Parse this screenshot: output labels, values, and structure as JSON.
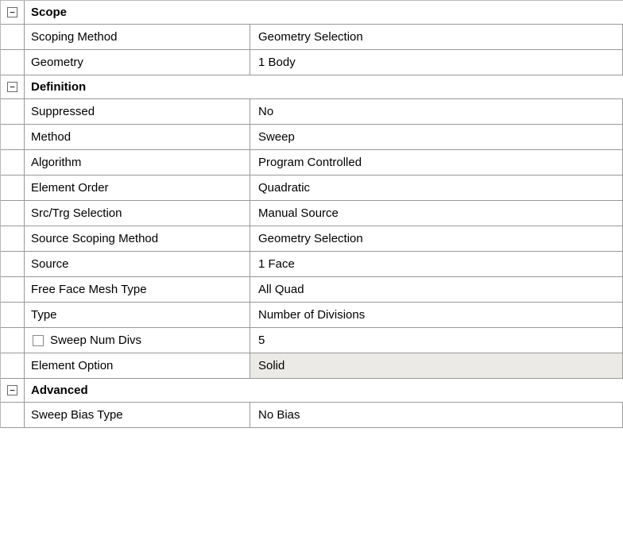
{
  "groups": [
    {
      "expand": "−",
      "title": "Scope",
      "rows": [
        {
          "label": "Scoping Method",
          "value": "Geometry Selection",
          "checkbox": false,
          "readonly": false
        },
        {
          "label": "Geometry",
          "value": "1 Body",
          "checkbox": false,
          "readonly": false
        }
      ]
    },
    {
      "expand": "−",
      "title": "Definition",
      "rows": [
        {
          "label": "Suppressed",
          "value": "No",
          "checkbox": false,
          "readonly": false
        },
        {
          "label": "Method",
          "value": "Sweep",
          "checkbox": false,
          "readonly": false
        },
        {
          "label": "Algorithm",
          "value": "Program Controlled",
          "checkbox": false,
          "readonly": false
        },
        {
          "label": "Element Order",
          "value": "Quadratic",
          "checkbox": false,
          "readonly": false
        },
        {
          "label": "Src/Trg Selection",
          "value": "Manual Source",
          "checkbox": false,
          "readonly": false
        },
        {
          "label": "Source Scoping Method",
          "value": "Geometry Selection",
          "checkbox": false,
          "readonly": false
        },
        {
          "label": "Source",
          "value": "1 Face",
          "checkbox": false,
          "readonly": false
        },
        {
          "label": "Free Face Mesh Type",
          "value": "All Quad",
          "checkbox": false,
          "readonly": false
        },
        {
          "label": "Type",
          "value": "Number of Divisions",
          "checkbox": false,
          "readonly": false
        },
        {
          "label": "Sweep Num Divs",
          "value": "5",
          "checkbox": true,
          "readonly": false
        },
        {
          "label": "Element Option",
          "value": "Solid",
          "checkbox": false,
          "readonly": true
        }
      ]
    },
    {
      "expand": "−",
      "title": "Advanced",
      "rows": [
        {
          "label": "Sweep Bias Type",
          "value": "No Bias",
          "checkbox": false,
          "readonly": false
        }
      ]
    }
  ]
}
